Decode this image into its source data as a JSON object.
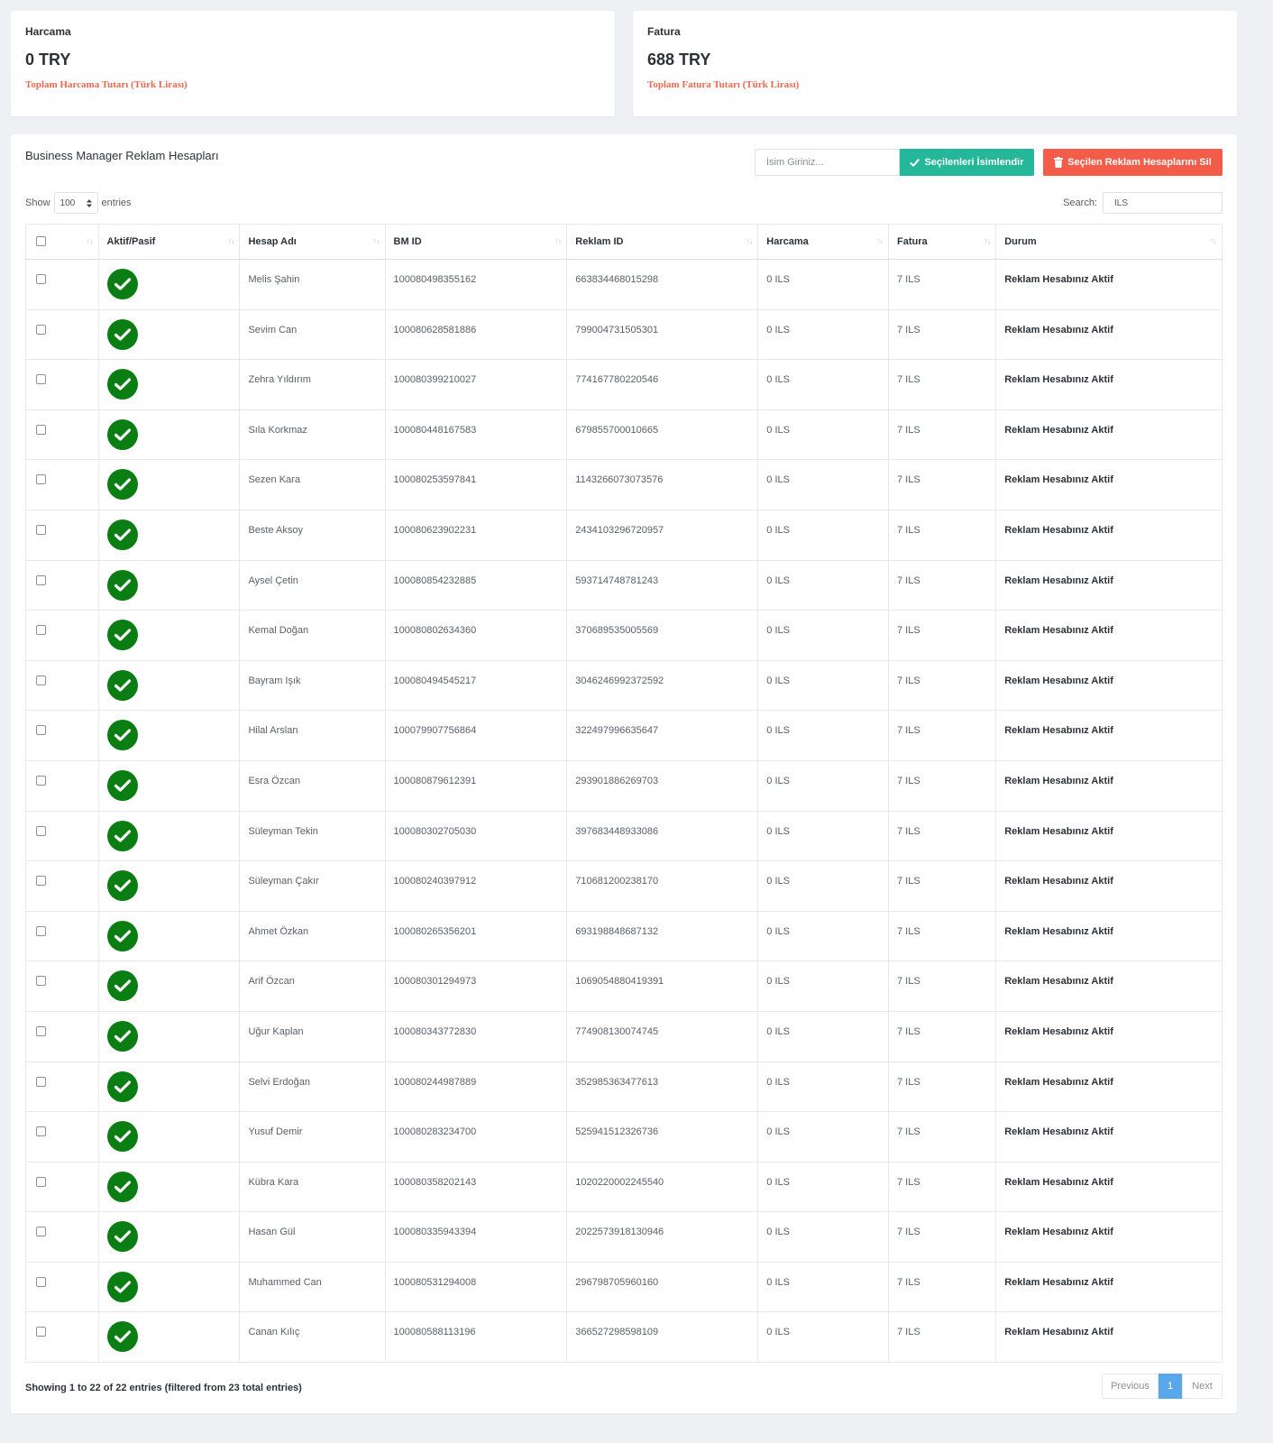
{
  "cards": {
    "spend": {
      "title": "Harcama",
      "value": "0 TRY",
      "subtitle": "Toplam Harcama Tutarı (Türk Lirası)"
    },
    "invoice": {
      "title": "Fatura",
      "value": "688 TRY",
      "subtitle": "Toplam Fatura Tutarı (Türk Lirası)"
    }
  },
  "panel": {
    "title": "Business Manager Reklam Hesapları",
    "name_placeholder": "İsim Giriniz...",
    "rename_label": "Seçilenleri İsimlendir",
    "delete_label": "Seçilen Reklam Hesaplarını Sil",
    "show_label": "Show",
    "entries_value": "100",
    "entries_label": "entries",
    "search_label": "Search:",
    "search_value": "ILS"
  },
  "table": {
    "headers": [
      "",
      "Aktif/Pasif",
      "Hesap Adı",
      "BM ID",
      "Reklam ID",
      "Harcama",
      "Fatura",
      "Durum"
    ],
    "rows": [
      {
        "name": "Melis Şahin",
        "bm_id": "100080498355162",
        "ad_id": "663834468015298",
        "spend": "0 ILS",
        "invoice": "7 ILS",
        "status": "Reklam Hesabınız Aktif"
      },
      {
        "name": "Sevim Can",
        "bm_id": "100080628581886",
        "ad_id": "799004731505301",
        "spend": "0 ILS",
        "invoice": "7 ILS",
        "status": "Reklam Hesabınız Aktif"
      },
      {
        "name": "Zehra Yıldırım",
        "bm_id": "100080399210027",
        "ad_id": "774167780220546",
        "spend": "0 ILS",
        "invoice": "7 ILS",
        "status": "Reklam Hesabınız Aktif"
      },
      {
        "name": "Sıla Korkmaz",
        "bm_id": "100080448167583",
        "ad_id": "679855700010665",
        "spend": "0 ILS",
        "invoice": "7 ILS",
        "status": "Reklam Hesabınız Aktif"
      },
      {
        "name": "Sezen Kara",
        "bm_id": "100080253597841",
        "ad_id": "1143266073073576",
        "spend": "0 ILS",
        "invoice": "7 ILS",
        "status": "Reklam Hesabınız Aktif"
      },
      {
        "name": "Beste Aksoy",
        "bm_id": "100080623902231",
        "ad_id": "2434103296720957",
        "spend": "0 ILS",
        "invoice": "7 ILS",
        "status": "Reklam Hesabınız Aktif"
      },
      {
        "name": "Aysel Çetin",
        "bm_id": "100080854232885",
        "ad_id": "593714748781243",
        "spend": "0 ILS",
        "invoice": "7 ILS",
        "status": "Reklam Hesabınız Aktif"
      },
      {
        "name": "Kemal Doğan",
        "bm_id": "100080802634360",
        "ad_id": "370689535005569",
        "spend": "0 ILS",
        "invoice": "7 ILS",
        "status": "Reklam Hesabınız Aktif"
      },
      {
        "name": "Bayram Işık",
        "bm_id": "100080494545217",
        "ad_id": "3046246992372592",
        "spend": "0 ILS",
        "invoice": "7 ILS",
        "status": "Reklam Hesabınız Aktif"
      },
      {
        "name": "Hilal Arslan",
        "bm_id": "100079907756864",
        "ad_id": "322497996635647",
        "spend": "0 ILS",
        "invoice": "7 ILS",
        "status": "Reklam Hesabınız Aktif"
      },
      {
        "name": "Esra Özcan",
        "bm_id": "100080879612391",
        "ad_id": "293901886269703",
        "spend": "0 ILS",
        "invoice": "7 ILS",
        "status": "Reklam Hesabınız Aktif"
      },
      {
        "name": "Süleyman Tekin",
        "bm_id": "100080302705030",
        "ad_id": "397683448933086",
        "spend": "0 ILS",
        "invoice": "7 ILS",
        "status": "Reklam Hesabınız Aktif"
      },
      {
        "name": "Süleyman Çakır",
        "bm_id": "100080240397912",
        "ad_id": "710681200238170",
        "spend": "0 ILS",
        "invoice": "7 ILS",
        "status": "Reklam Hesabınız Aktif"
      },
      {
        "name": "Ahmet Özkan",
        "bm_id": "100080265356201",
        "ad_id": "693198848687132",
        "spend": "0 ILS",
        "invoice": "7 ILS",
        "status": "Reklam Hesabınız Aktif"
      },
      {
        "name": "Arif Özcan",
        "bm_id": "100080301294973",
        "ad_id": "1069054880419391",
        "spend": "0 ILS",
        "invoice": "7 ILS",
        "status": "Reklam Hesabınız Aktif"
      },
      {
        "name": "Uğur Kaplan",
        "bm_id": "100080343772830",
        "ad_id": "774908130074745",
        "spend": "0 ILS",
        "invoice": "7 ILS",
        "status": "Reklam Hesabınız Aktif"
      },
      {
        "name": "Selvi Erdoğan",
        "bm_id": "100080244987889",
        "ad_id": "352985363477613",
        "spend": "0 ILS",
        "invoice": "7 ILS",
        "status": "Reklam Hesabınız Aktif"
      },
      {
        "name": "Yusuf Demir",
        "bm_id": "100080283234700",
        "ad_id": "525941512326736",
        "spend": "0 ILS",
        "invoice": "7 ILS",
        "status": "Reklam Hesabınız Aktif"
      },
      {
        "name": "Kübra Kara",
        "bm_id": "100080358202143",
        "ad_id": "1020220002245540",
        "spend": "0 ILS",
        "invoice": "7 ILS",
        "status": "Reklam Hesabınız Aktif"
      },
      {
        "name": "Hasan Gül",
        "bm_id": "100080335943394",
        "ad_id": "2022573918130946",
        "spend": "0 ILS",
        "invoice": "7 ILS",
        "status": "Reklam Hesabınız Aktif"
      },
      {
        "name": "Muhammed Can",
        "bm_id": "100080531294008",
        "ad_id": "296798705960160",
        "spend": "0 ILS",
        "invoice": "7 ILS",
        "status": "Reklam Hesabınız Aktif"
      },
      {
        "name": "Canan Kılıç",
        "bm_id": "100080588113196",
        "ad_id": "366527298598109",
        "spend": "0 ILS",
        "invoice": "7 ILS",
        "status": "Reklam Hesabınız Aktif"
      }
    ]
  },
  "footer": {
    "info": "Showing 1 to 22 of 22 entries (filtered from 23 total entries)",
    "previous": "Previous",
    "current_page": "1",
    "next": "Next"
  },
  "icons": {
    "active": "check-circle-icon",
    "rename": "check-icon",
    "delete": "trash-icon"
  },
  "colors": {
    "accent_green": "#24b79a",
    "danger": "#f25c48",
    "active_icon": "#0a7e12",
    "subtitle": "#f0674f",
    "page_active": "#5aa7ec"
  }
}
